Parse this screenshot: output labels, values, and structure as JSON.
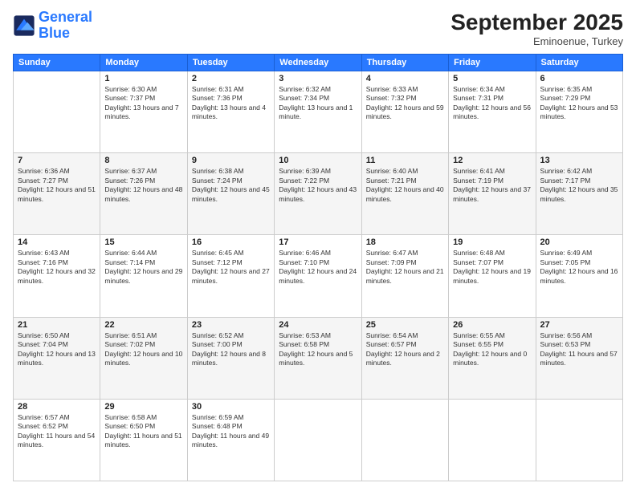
{
  "header": {
    "logo_line1": "General",
    "logo_line2": "Blue",
    "month": "September 2025",
    "location": "Eminoenue, Turkey"
  },
  "weekdays": [
    "Sunday",
    "Monday",
    "Tuesday",
    "Wednesday",
    "Thursday",
    "Friday",
    "Saturday"
  ],
  "weeks": [
    [
      {
        "day": "",
        "sunrise": "",
        "sunset": "",
        "daylight": ""
      },
      {
        "day": "1",
        "sunrise": "Sunrise: 6:30 AM",
        "sunset": "Sunset: 7:37 PM",
        "daylight": "Daylight: 13 hours and 7 minutes."
      },
      {
        "day": "2",
        "sunrise": "Sunrise: 6:31 AM",
        "sunset": "Sunset: 7:36 PM",
        "daylight": "Daylight: 13 hours and 4 minutes."
      },
      {
        "day": "3",
        "sunrise": "Sunrise: 6:32 AM",
        "sunset": "Sunset: 7:34 PM",
        "daylight": "Daylight: 13 hours and 1 minute."
      },
      {
        "day": "4",
        "sunrise": "Sunrise: 6:33 AM",
        "sunset": "Sunset: 7:32 PM",
        "daylight": "Daylight: 12 hours and 59 minutes."
      },
      {
        "day": "5",
        "sunrise": "Sunrise: 6:34 AM",
        "sunset": "Sunset: 7:31 PM",
        "daylight": "Daylight: 12 hours and 56 minutes."
      },
      {
        "day": "6",
        "sunrise": "Sunrise: 6:35 AM",
        "sunset": "Sunset: 7:29 PM",
        "daylight": "Daylight: 12 hours and 53 minutes."
      }
    ],
    [
      {
        "day": "7",
        "sunrise": "Sunrise: 6:36 AM",
        "sunset": "Sunset: 7:27 PM",
        "daylight": "Daylight: 12 hours and 51 minutes."
      },
      {
        "day": "8",
        "sunrise": "Sunrise: 6:37 AM",
        "sunset": "Sunset: 7:26 PM",
        "daylight": "Daylight: 12 hours and 48 minutes."
      },
      {
        "day": "9",
        "sunrise": "Sunrise: 6:38 AM",
        "sunset": "Sunset: 7:24 PM",
        "daylight": "Daylight: 12 hours and 45 minutes."
      },
      {
        "day": "10",
        "sunrise": "Sunrise: 6:39 AM",
        "sunset": "Sunset: 7:22 PM",
        "daylight": "Daylight: 12 hours and 43 minutes."
      },
      {
        "day": "11",
        "sunrise": "Sunrise: 6:40 AM",
        "sunset": "Sunset: 7:21 PM",
        "daylight": "Daylight: 12 hours and 40 minutes."
      },
      {
        "day": "12",
        "sunrise": "Sunrise: 6:41 AM",
        "sunset": "Sunset: 7:19 PM",
        "daylight": "Daylight: 12 hours and 37 minutes."
      },
      {
        "day": "13",
        "sunrise": "Sunrise: 6:42 AM",
        "sunset": "Sunset: 7:17 PM",
        "daylight": "Daylight: 12 hours and 35 minutes."
      }
    ],
    [
      {
        "day": "14",
        "sunrise": "Sunrise: 6:43 AM",
        "sunset": "Sunset: 7:16 PM",
        "daylight": "Daylight: 12 hours and 32 minutes."
      },
      {
        "day": "15",
        "sunrise": "Sunrise: 6:44 AM",
        "sunset": "Sunset: 7:14 PM",
        "daylight": "Daylight: 12 hours and 29 minutes."
      },
      {
        "day": "16",
        "sunrise": "Sunrise: 6:45 AM",
        "sunset": "Sunset: 7:12 PM",
        "daylight": "Daylight: 12 hours and 27 minutes."
      },
      {
        "day": "17",
        "sunrise": "Sunrise: 6:46 AM",
        "sunset": "Sunset: 7:10 PM",
        "daylight": "Daylight: 12 hours and 24 minutes."
      },
      {
        "day": "18",
        "sunrise": "Sunrise: 6:47 AM",
        "sunset": "Sunset: 7:09 PM",
        "daylight": "Daylight: 12 hours and 21 minutes."
      },
      {
        "day": "19",
        "sunrise": "Sunrise: 6:48 AM",
        "sunset": "Sunset: 7:07 PM",
        "daylight": "Daylight: 12 hours and 19 minutes."
      },
      {
        "day": "20",
        "sunrise": "Sunrise: 6:49 AM",
        "sunset": "Sunset: 7:05 PM",
        "daylight": "Daylight: 12 hours and 16 minutes."
      }
    ],
    [
      {
        "day": "21",
        "sunrise": "Sunrise: 6:50 AM",
        "sunset": "Sunset: 7:04 PM",
        "daylight": "Daylight: 12 hours and 13 minutes."
      },
      {
        "day": "22",
        "sunrise": "Sunrise: 6:51 AM",
        "sunset": "Sunset: 7:02 PM",
        "daylight": "Daylight: 12 hours and 10 minutes."
      },
      {
        "day": "23",
        "sunrise": "Sunrise: 6:52 AM",
        "sunset": "Sunset: 7:00 PM",
        "daylight": "Daylight: 12 hours and 8 minutes."
      },
      {
        "day": "24",
        "sunrise": "Sunrise: 6:53 AM",
        "sunset": "Sunset: 6:58 PM",
        "daylight": "Daylight: 12 hours and 5 minutes."
      },
      {
        "day": "25",
        "sunrise": "Sunrise: 6:54 AM",
        "sunset": "Sunset: 6:57 PM",
        "daylight": "Daylight: 12 hours and 2 minutes."
      },
      {
        "day": "26",
        "sunrise": "Sunrise: 6:55 AM",
        "sunset": "Sunset: 6:55 PM",
        "daylight": "Daylight: 12 hours and 0 minutes."
      },
      {
        "day": "27",
        "sunrise": "Sunrise: 6:56 AM",
        "sunset": "Sunset: 6:53 PM",
        "daylight": "Daylight: 11 hours and 57 minutes."
      }
    ],
    [
      {
        "day": "28",
        "sunrise": "Sunrise: 6:57 AM",
        "sunset": "Sunset: 6:52 PM",
        "daylight": "Daylight: 11 hours and 54 minutes."
      },
      {
        "day": "29",
        "sunrise": "Sunrise: 6:58 AM",
        "sunset": "Sunset: 6:50 PM",
        "daylight": "Daylight: 11 hours and 51 minutes."
      },
      {
        "day": "30",
        "sunrise": "Sunrise: 6:59 AM",
        "sunset": "Sunset: 6:48 PM",
        "daylight": "Daylight: 11 hours and 49 minutes."
      },
      {
        "day": "",
        "sunrise": "",
        "sunset": "",
        "daylight": ""
      },
      {
        "day": "",
        "sunrise": "",
        "sunset": "",
        "daylight": ""
      },
      {
        "day": "",
        "sunrise": "",
        "sunset": "",
        "daylight": ""
      },
      {
        "day": "",
        "sunrise": "",
        "sunset": "",
        "daylight": ""
      }
    ]
  ]
}
